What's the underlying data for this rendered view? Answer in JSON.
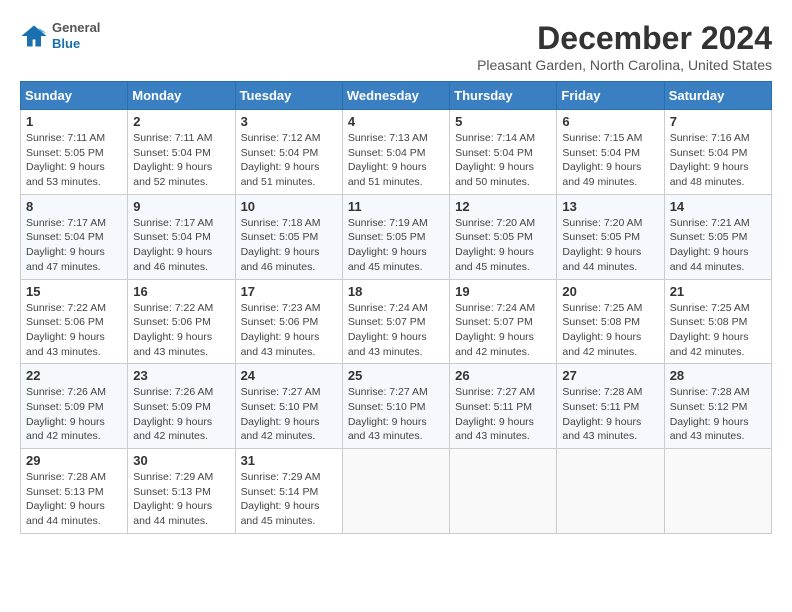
{
  "logo": {
    "general": "General",
    "blue": "Blue"
  },
  "header": {
    "title": "December 2024",
    "location": "Pleasant Garden, North Carolina, United States"
  },
  "weekdays": [
    "Sunday",
    "Monday",
    "Tuesday",
    "Wednesday",
    "Thursday",
    "Friday",
    "Saturday"
  ],
  "weeks": [
    [
      {
        "day": "1",
        "sunrise": "7:11 AM",
        "sunset": "5:05 PM",
        "daylight": "9 hours and 53 minutes."
      },
      {
        "day": "2",
        "sunrise": "7:11 AM",
        "sunset": "5:04 PM",
        "daylight": "9 hours and 52 minutes."
      },
      {
        "day": "3",
        "sunrise": "7:12 AM",
        "sunset": "5:04 PM",
        "daylight": "9 hours and 51 minutes."
      },
      {
        "day": "4",
        "sunrise": "7:13 AM",
        "sunset": "5:04 PM",
        "daylight": "9 hours and 51 minutes."
      },
      {
        "day": "5",
        "sunrise": "7:14 AM",
        "sunset": "5:04 PM",
        "daylight": "9 hours and 50 minutes."
      },
      {
        "day": "6",
        "sunrise": "7:15 AM",
        "sunset": "5:04 PM",
        "daylight": "9 hours and 49 minutes."
      },
      {
        "day": "7",
        "sunrise": "7:16 AM",
        "sunset": "5:04 PM",
        "daylight": "9 hours and 48 minutes."
      }
    ],
    [
      {
        "day": "8",
        "sunrise": "7:17 AM",
        "sunset": "5:04 PM",
        "daylight": "9 hours and 47 minutes."
      },
      {
        "day": "9",
        "sunrise": "7:17 AM",
        "sunset": "5:04 PM",
        "daylight": "9 hours and 46 minutes."
      },
      {
        "day": "10",
        "sunrise": "7:18 AM",
        "sunset": "5:05 PM",
        "daylight": "9 hours and 46 minutes."
      },
      {
        "day": "11",
        "sunrise": "7:19 AM",
        "sunset": "5:05 PM",
        "daylight": "9 hours and 45 minutes."
      },
      {
        "day": "12",
        "sunrise": "7:20 AM",
        "sunset": "5:05 PM",
        "daylight": "9 hours and 45 minutes."
      },
      {
        "day": "13",
        "sunrise": "7:20 AM",
        "sunset": "5:05 PM",
        "daylight": "9 hours and 44 minutes."
      },
      {
        "day": "14",
        "sunrise": "7:21 AM",
        "sunset": "5:05 PM",
        "daylight": "9 hours and 44 minutes."
      }
    ],
    [
      {
        "day": "15",
        "sunrise": "7:22 AM",
        "sunset": "5:06 PM",
        "daylight": "9 hours and 43 minutes."
      },
      {
        "day": "16",
        "sunrise": "7:22 AM",
        "sunset": "5:06 PM",
        "daylight": "9 hours and 43 minutes."
      },
      {
        "day": "17",
        "sunrise": "7:23 AM",
        "sunset": "5:06 PM",
        "daylight": "9 hours and 43 minutes."
      },
      {
        "day": "18",
        "sunrise": "7:24 AM",
        "sunset": "5:07 PM",
        "daylight": "9 hours and 43 minutes."
      },
      {
        "day": "19",
        "sunrise": "7:24 AM",
        "sunset": "5:07 PM",
        "daylight": "9 hours and 42 minutes."
      },
      {
        "day": "20",
        "sunrise": "7:25 AM",
        "sunset": "5:08 PM",
        "daylight": "9 hours and 42 minutes."
      },
      {
        "day": "21",
        "sunrise": "7:25 AM",
        "sunset": "5:08 PM",
        "daylight": "9 hours and 42 minutes."
      }
    ],
    [
      {
        "day": "22",
        "sunrise": "7:26 AM",
        "sunset": "5:09 PM",
        "daylight": "9 hours and 42 minutes."
      },
      {
        "day": "23",
        "sunrise": "7:26 AM",
        "sunset": "5:09 PM",
        "daylight": "9 hours and 42 minutes."
      },
      {
        "day": "24",
        "sunrise": "7:27 AM",
        "sunset": "5:10 PM",
        "daylight": "9 hours and 42 minutes."
      },
      {
        "day": "25",
        "sunrise": "7:27 AM",
        "sunset": "5:10 PM",
        "daylight": "9 hours and 43 minutes."
      },
      {
        "day": "26",
        "sunrise": "7:27 AM",
        "sunset": "5:11 PM",
        "daylight": "9 hours and 43 minutes."
      },
      {
        "day": "27",
        "sunrise": "7:28 AM",
        "sunset": "5:11 PM",
        "daylight": "9 hours and 43 minutes."
      },
      {
        "day": "28",
        "sunrise": "7:28 AM",
        "sunset": "5:12 PM",
        "daylight": "9 hours and 43 minutes."
      }
    ],
    [
      {
        "day": "29",
        "sunrise": "7:28 AM",
        "sunset": "5:13 PM",
        "daylight": "9 hours and 44 minutes."
      },
      {
        "day": "30",
        "sunrise": "7:29 AM",
        "sunset": "5:13 PM",
        "daylight": "9 hours and 44 minutes."
      },
      {
        "day": "31",
        "sunrise": "7:29 AM",
        "sunset": "5:14 PM",
        "daylight": "9 hours and 45 minutes."
      },
      null,
      null,
      null,
      null
    ]
  ]
}
